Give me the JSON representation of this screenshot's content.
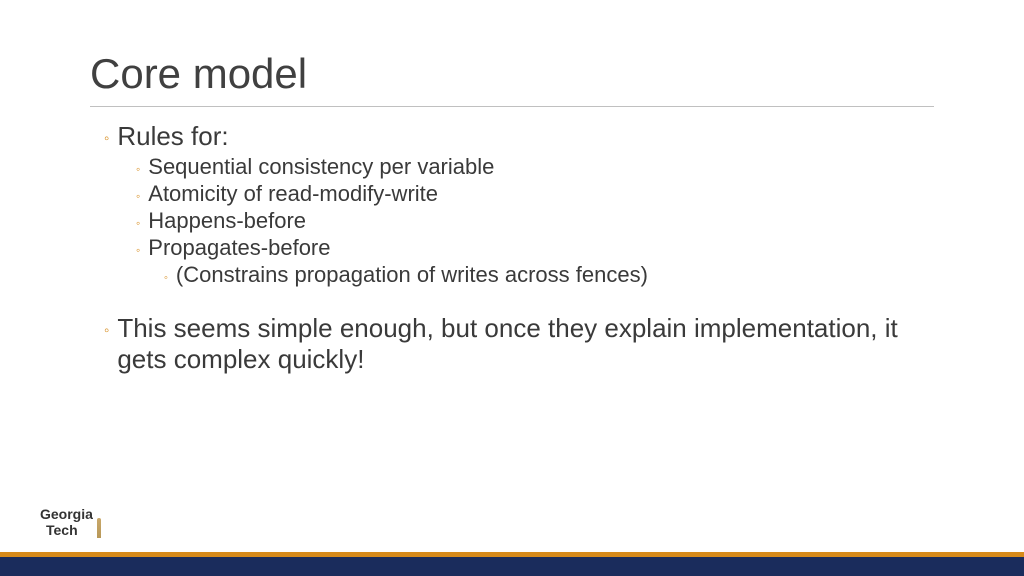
{
  "title": "Core model",
  "bullets": {
    "rules_for": "Rules for:",
    "seq_consistency": "Sequential consistency per variable",
    "atomicity": "Atomicity of read-modify-write",
    "happens_before": "Happens-before",
    "propagates_before": "Propagates-before",
    "constrains": "(Constrains propagation of writes across fences)",
    "simple_enough": "This seems simple enough, but once they explain implementation, it gets complex quickly!"
  },
  "logo": {
    "line1": "Georgia",
    "line2": "Tech"
  }
}
